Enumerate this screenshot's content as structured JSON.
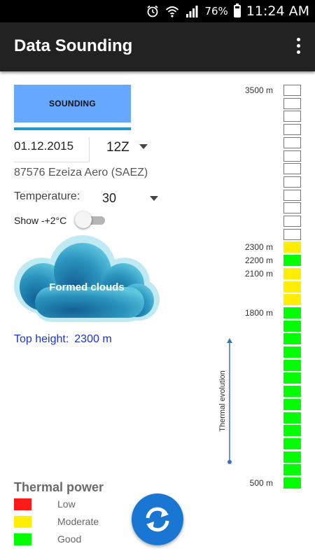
{
  "status_bar": {
    "time": "11:24 AM",
    "battery_percent": "76%",
    "battery_level": 0.76,
    "icons": [
      "alarm-icon",
      "wifi-icon",
      "signal-icon",
      "battery-icon"
    ]
  },
  "app_bar": {
    "title": "Data Sounding",
    "menu_icon": "overflow-menu-icon"
  },
  "tab": {
    "label": "SOUNDING"
  },
  "form": {
    "date": "01.12.2015",
    "hour": "12Z",
    "station": "87576 Ezeiza Aero (SAEZ)",
    "temperature_label": "Temperature:",
    "temperature_value": "30",
    "show_label": "Show -+2°C",
    "show_toggle_on": false
  },
  "cloud": {
    "label": "Formed clouds"
  },
  "top_height": {
    "label": "Top height:",
    "value": "2300 m"
  },
  "legend": {
    "title": "Thermal power",
    "items": [
      {
        "label": "Low",
        "color": "#ff1a1a"
      },
      {
        "label": "Moderate",
        "color": "#ffee00"
      },
      {
        "label": "Good",
        "color": "#00ff00"
      }
    ]
  },
  "refresh_icon": "refresh-icon",
  "thermal_axis_label": "Thermal evolution",
  "altitude_levels": [
    {
      "power": "none"
    },
    {
      "power": "none"
    },
    {
      "power": "none"
    },
    {
      "power": "none"
    },
    {
      "power": "none"
    },
    {
      "power": "none"
    },
    {
      "power": "none"
    },
    {
      "power": "none"
    },
    {
      "power": "none"
    },
    {
      "power": "none"
    },
    {
      "power": "none"
    },
    {
      "power": "none"
    },
    {
      "power": "moderate"
    },
    {
      "power": "good"
    },
    {
      "power": "moderate"
    },
    {
      "power": "moderate"
    },
    {
      "power": "moderate"
    },
    {
      "power": "good"
    },
    {
      "power": "good"
    },
    {
      "power": "good"
    },
    {
      "power": "good"
    },
    {
      "power": "good"
    },
    {
      "power": "good"
    },
    {
      "power": "good"
    },
    {
      "power": "good"
    },
    {
      "power": "good"
    },
    {
      "power": "good"
    },
    {
      "power": "good"
    },
    {
      "power": "good"
    },
    {
      "power": "good"
    },
    {
      "power": "good"
    }
  ],
  "altitude_labels": [
    {
      "level_index": 0,
      "text": "3500 m"
    },
    {
      "level_index": 12,
      "text": "2300 m"
    },
    {
      "level_index": 13,
      "text": "2200 m"
    },
    {
      "level_index": 14,
      "text": "2100 m"
    },
    {
      "level_index": 17,
      "text": "1800 m"
    },
    {
      "level_index": 30,
      "text": "500 m"
    }
  ],
  "colors": {
    "tab_bg": "#66a8ff",
    "tab_indicator": "#2196c8",
    "accent_blue": "#1976d2",
    "link_blue": "#1b33d8",
    "cell_empty_border": "#777777",
    "moderate": "#ffee00",
    "good": "#00ff00",
    "low": "#ff1a1a"
  }
}
